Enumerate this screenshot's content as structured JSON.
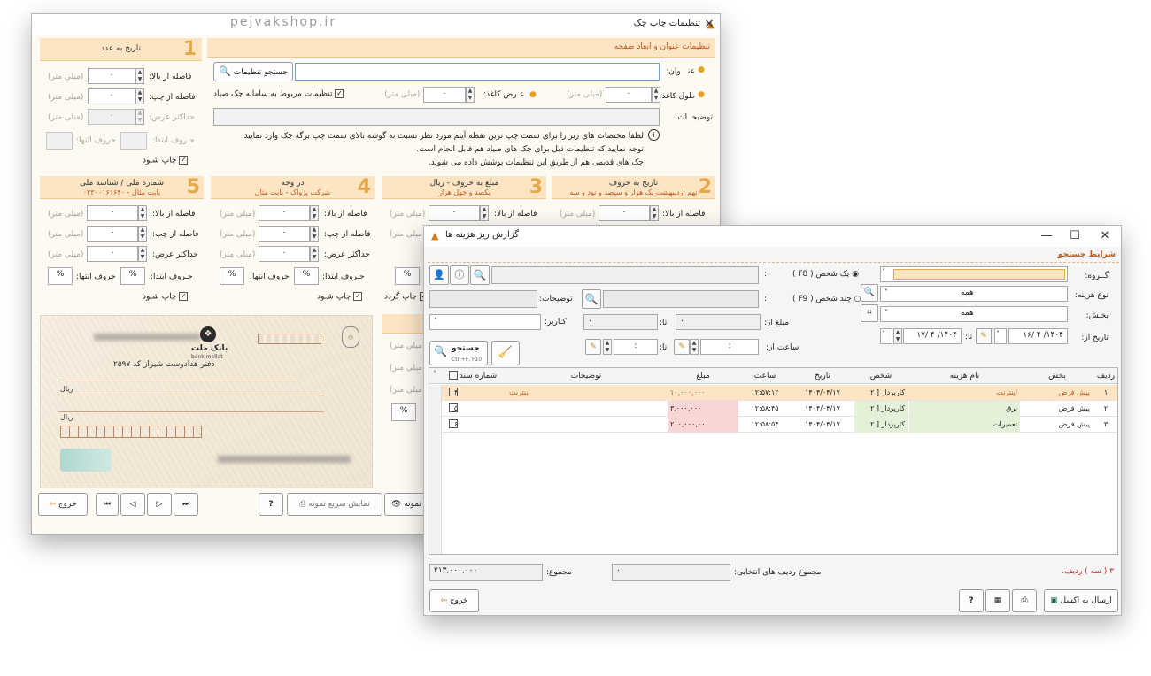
{
  "watermark": "pejvakshop.ir",
  "win1": {
    "title": "تنظیمات چاپ چک",
    "header_title": "تنظیمات عنوان و ابعاد صفحه",
    "title_label": "عنـــوان:",
    "search_btn": "جستجو تنظیمات",
    "paper_len_label": "طول کاغذ:",
    "paper_len_val": "۰",
    "paper_unit": "(میلی متر)",
    "paper_w_label": "عـرض کاغذ:",
    "paper_w_val": "۰",
    "sayad_chk": "تنظیمات مربوط به سامانه چک صیاد",
    "desc_label": "توضیحــات:",
    "info1": "لطفا مختصات های زیر را برای سمت چپ ترین نقطه آیتم مورد نظر نسبت به گوشه بالای سمت چپ برگه چک وارد نمایید.",
    "info2": "توجه نمایید که تنظیمات ذیل برای چک های صیاد هم قابل انجام است.",
    "info3": "چک های قدیمی هم از طریق این تنظیمات پوشش داده می شوند.",
    "sec1": {
      "num": "1",
      "t1": "تاریخ به عدد",
      "t2": ""
    },
    "sec2": {
      "num": "2",
      "t1": "تاریخ به حروف",
      "t2": "نهم اردیبهشت یک هزار و سیصد و نود و سه"
    },
    "sec3": {
      "num": "3",
      "t1": "مبلغ به حروف - ریال",
      "t2": "یکصد و چهل هزار"
    },
    "sec4": {
      "num": "4",
      "t1": "در وجه",
      "t2": "شرکت پژواک - بابت مثال"
    },
    "sec5": {
      "num": "5",
      "t1": "شماره ملی / شناسه ملی",
      "t2": "۰۲۳۰۰۱۶۱۶۴۰ - بابت مثال"
    },
    "f_top": "فاصله از بالا:",
    "f_left": "فاصله از چپ:",
    "f_maxw": "حداکثر عرض:",
    "f_chars": "حـروف ابتدا:",
    "f_charsend": "حروف انتها:",
    "zero": "۰",
    "pct": "%",
    "unit": "(میلی متر)",
    "print_chk": "چاپ شـود",
    "print_chk2": "چاپ گردد",
    "bank_name": "بانک ملت",
    "bank_en": "bank mellat",
    "branch": "دفتر هدادوست شیراز کد ۲۵۹۷",
    "rial": "ریال",
    "btn_exit": "خروج",
    "btn_preview": "نمایش سریع نمونه",
    "btn_sample": "نمونه"
  },
  "win2": {
    "title": "گزارش ریز هزینه ها",
    "search_conditions": "شرایط جستجو",
    "group_label": "گــروه:",
    "cost_type_label": "نوع هزینه:",
    "cost_type_val": "همه",
    "section_label": "بخـش:",
    "section_val": "همه",
    "date_from_label": "تاریخ از:",
    "date_from_val": "۱۴۰۴/ ۴ /۱۶",
    "date_to_label": "تا:",
    "date_to_val": "۱۴۰۴/ ۴ /۱۷",
    "one_person": "یک شخص ( F8 )",
    "multi_person": "چند شخص ( F9 )",
    "colon": ":",
    "desc_label": "توضیحات:",
    "amount_from": "مبلغ از:",
    "amount_val": "۰",
    "to": "تا:",
    "user_label": "کـاربر:",
    "time_from": "ساعت از:",
    "time_val": ":",
    "search_btn": "جستجو",
    "search_hint": "Ctrl+F, F10",
    "columns": [
      "ردیف",
      "بخش",
      "نام هزینه",
      "شخص",
      "تاریخ",
      "ساعت",
      "مبلغ",
      "توضیحات",
      "شماره سند"
    ],
    "rows": [
      {
        "idx": "۱",
        "section": "پیش فرض",
        "cost": "اینترنت",
        "person": "کارپرداز [ ۲",
        "date": "۱۴۰۴/۰۴/۱۷",
        "time": "۱۲:۵۷:۱۲",
        "amount": "۱۰,۰۰۰,۰۰۰",
        "desc": "اینترنت",
        "doc": "۴"
      },
      {
        "idx": "۲",
        "section": "پیش فرض",
        "cost": "برق",
        "person": "کارپرداز [ ۲",
        "date": "۱۴۰۴/۰۴/۱۷",
        "time": "۱۲:۵۸:۴۵",
        "amount": "۳,۰۰۰,۰۰۰",
        "desc": "",
        "doc": "۵"
      },
      {
        "idx": "۳",
        "section": "پیش فرض",
        "cost": "تعمیرات",
        "person": "کارپرداز [ ۲",
        "date": "۱۴۰۴/۰۴/۱۷",
        "time": "۱۲:۵۸:۵۴",
        "amount": "۲۰۰,۰۰۰,۰۰۰",
        "desc": "",
        "doc": "۶"
      }
    ],
    "row_count": "۳ ( سه ) ردیف.",
    "sel_sum_label": "مجموع ردیف های انتخابی:",
    "sel_sum_val": "۰",
    "total_label": "مجموع:",
    "total_val": "۲۱۳,۰۰۰,۰۰۰",
    "excel_btn": "ارسال به اکسل",
    "exit_btn": "خروج"
  }
}
